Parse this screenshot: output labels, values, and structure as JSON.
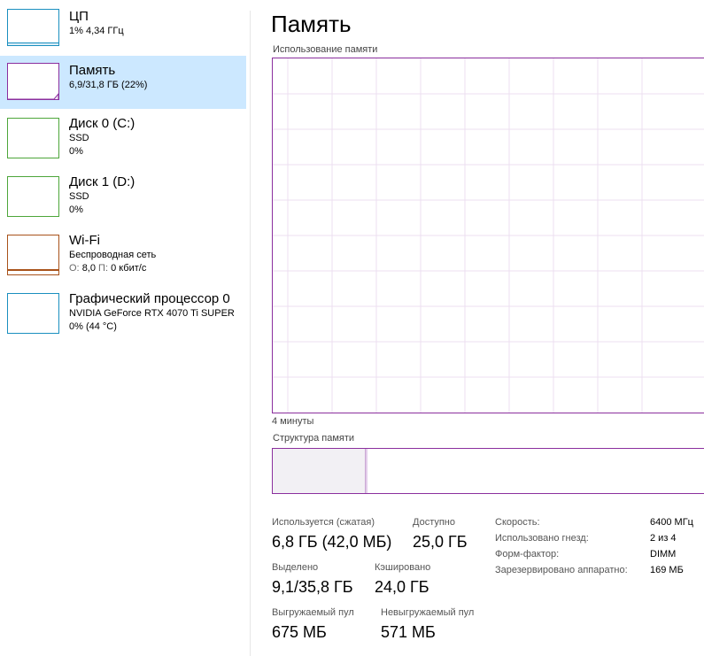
{
  "sidebar": {
    "items": [
      {
        "title": "ЦП",
        "line1": "1% 4,34 ГГц",
        "line2": "",
        "color": "#1a8fbf",
        "selected": false
      },
      {
        "title": "Память",
        "line1": "6,9/31,8 ГБ (22%)",
        "line2": "",
        "color": "#8b2f9e",
        "selected": true
      },
      {
        "title": "Диск 0 (C:)",
        "line1": "SSD",
        "line2": "0%",
        "color": "#4da63a",
        "selected": false
      },
      {
        "title": "Диск 1 (D:)",
        "line1": "SSD",
        "line2": "0%",
        "color": "#4da63a",
        "selected": false
      },
      {
        "title": "Wi-Fi",
        "line1": "Беспроводная сеть",
        "line2_label_send": "О:",
        "line2_send": "8,0",
        "line2_label_recv": "П:",
        "line2_recv": "0 кбит/с",
        "color": "#a8521a",
        "selected": false
      },
      {
        "title": "Графический процессор 0",
        "line1": "NVIDIA GeForce RTX 4070 Ti SUPER",
        "line2": "0% (44 °C)",
        "color": "#1a8fbf",
        "selected": false
      }
    ]
  },
  "main": {
    "title": "Память",
    "graph_label": "Использование памяти",
    "time_label": "4 минуты",
    "structure_label": "Структура памяти",
    "usage_fraction": 0.22,
    "accent_color": "#8b2f9e",
    "grid_color": "#ecdff0"
  },
  "stats": {
    "in_use_label": "Используется (сжатая)",
    "in_use_value": "6,8 ГБ (42,0 МБ)",
    "available_label": "Доступно",
    "available_value": "25,0 ГБ",
    "committed_label": "Выделено",
    "committed_value": "9,1/35,8 ГБ",
    "cached_label": "Кэшировано",
    "cached_value": "24,0 ГБ",
    "paged_label": "Выгружаемый пул",
    "paged_value": "675 МБ",
    "nonpaged_label": "Невыгружаемый пул",
    "nonpaged_value": "571 МБ"
  },
  "hardware": {
    "speed_label": "Скорость:",
    "speed_value": "6400 МГц",
    "slots_label": "Использовано гнезд:",
    "slots_value": "2 из 4",
    "form_label": "Форм-фактор:",
    "form_value": "DIMM",
    "reserved_label": "Зарезервировано аппаратно:",
    "reserved_value": "169 МБ"
  }
}
